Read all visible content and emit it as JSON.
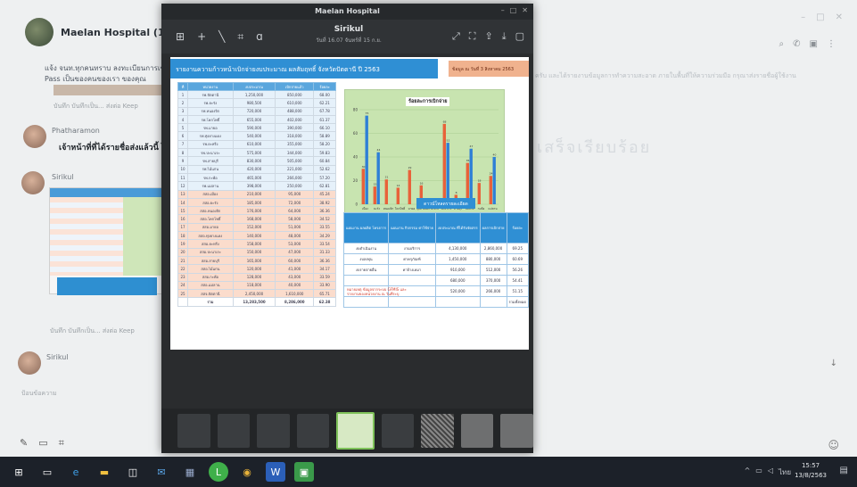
{
  "chat": {
    "group_name": "Maelan Hospital (171)",
    "first_message": "แจ้ง จนท.ทุกคนทราบ ลงทะเบียนการเข้าร่วม...",
    "first_message_sub": "Pass เป็นของคนของเรา ของคุณ",
    "read_meta": "บันทึก   บันทึกเป็น...   ส่งต่อ   Keep",
    "sender1": "Phatharamon",
    "bubble1": "เจ้าหน้าที่ที่ได้รายชื่อส่งแล้วนี้ ไ",
    "sender2": "Sirikul",
    "read_meta2": "บันทึก   บันทึกเป็น...   ส่งต่อ   Keep",
    "sender3": "Sirikul",
    "input_placeholder": "ป้อนข้อความ",
    "bg_text": "ครับ และได้รายงานข้อมูลการทำความสะอาด ภายในพื้นที่ให้ความร่วมมือ กรุณาส่งรายชื่อผู้ใช้งาน",
    "bg_big": "เสร็จเรียบร้อย"
  },
  "viewer": {
    "title": "Maelan Hospital",
    "sender": "Sirikul",
    "date": "วันที่ 16.07 จันทร์ที่ 15 ก.ย.",
    "doc_title": "รายงานความก้าวหน้าเบิกจ่ายงบประมาณ ผลสัมฤทธิ์ จังหวัดปัตตานี ปี 2563",
    "doc_badge": "ข้อมูล ณ วันที่ 3 สิงหาคม 2563",
    "table_headers": [
      "ที่",
      "หน่วยงาน",
      "งบประมาณ",
      "เบิกจ่ายแล้ว",
      "ร้อยละ"
    ],
    "table_rows": [
      [
        "1",
        "รพ.ปัตตานี",
        "1,250,000",
        "850,000",
        "68.00"
      ],
      [
        "2",
        "รพ.ยะรัง",
        "980,500",
        "610,000",
        "62.21"
      ],
      [
        "3",
        "รพ.หนองจิก",
        "720,000",
        "488,000",
        "67.78"
      ],
      [
        "4",
        "รพ.โคกโพธิ์",
        "655,000",
        "402,000",
        "61.37"
      ],
      [
        "5",
        "รพ.มายอ",
        "590,000",
        "390,000",
        "66.10"
      ],
      [
        "6",
        "รพ.ทุ่งยางแดง",
        "540,000",
        "318,000",
        "58.89"
      ],
      [
        "7",
        "รพ.ยะหริ่ง",
        "610,000",
        "355,000",
        "58.20"
      ],
      [
        "8",
        "รพ.ปะนาเระ",
        "575,000",
        "344,000",
        "59.83"
      ],
      [
        "9",
        "รพ.สายบุรี",
        "830,000",
        "505,000",
        "60.84"
      ],
      [
        "10",
        "รพ.ไม้แก่น",
        "420,000",
        "221,000",
        "52.62"
      ],
      [
        "11",
        "รพ.กะพ้อ",
        "465,000",
        "266,000",
        "57.20"
      ],
      [
        "12",
        "รพ.แม่ลาน",
        "398,000",
        "250,000",
        "62.81"
      ],
      [
        "13",
        "สสอ.เมือง",
        "210,000",
        "95,000",
        "45.24"
      ],
      [
        "14",
        "สสอ.ยะรัง",
        "185,000",
        "72,000",
        "38.92"
      ],
      [
        "15",
        "สสอ.หนองจิก",
        "176,000",
        "64,000",
        "36.36"
      ],
      [
        "16",
        "สสอ.โคกโพธิ์",
        "168,000",
        "58,000",
        "34.52"
      ],
      [
        "17",
        "สสอ.มายอ",
        "152,000",
        "51,000",
        "33.55"
      ],
      [
        "18",
        "สสอ.ทุ่งยางแดง",
        "140,000",
        "48,000",
        "34.29"
      ],
      [
        "19",
        "สสอ.ยะหริ่ง",
        "158,000",
        "53,000",
        "33.54"
      ],
      [
        "20",
        "สสอ.ปะนาเระ",
        "150,000",
        "47,000",
        "31.33"
      ],
      [
        "21",
        "สสอ.สายบุรี",
        "165,000",
        "60,000",
        "36.36"
      ],
      [
        "22",
        "สสอ.ไม้แก่น",
        "120,000",
        "41,000",
        "34.17"
      ],
      [
        "23",
        "สสอ.กะพ้อ",
        "128,000",
        "43,000",
        "33.59"
      ],
      [
        "24",
        "สสอ.แม่ลาน",
        "118,000",
        "40,000",
        "33.90"
      ],
      [
        "25",
        "สสจ.ปัตตานี",
        "2,450,000",
        "1,610,000",
        "65.71"
      ]
    ],
    "table_total": [
      "",
      "รวม",
      "13,283,500",
      "8,286,000",
      "62.38"
    ],
    "chart_title": "ร้อยละการเบิกจ่าย",
    "chart_legend": "■ โรงพยาบาล   ■ สำนักงานสาธารณสุขอำเภอ",
    "download_label": "ดาวน์โหลดรายละเอียด",
    "summary_headers": [
      "แผนงาน ผลผลิต โครงการ",
      "แผนงาน กิจกรรม ค่าใช้จ่าย",
      "งบประมาณ ที่ได้รับจัดสรร",
      "ผลการเบิกจ่าย",
      "ร้อยละ"
    ],
    "summary_rows": [
      [
        "งบดำเนินงาน",
        "งานบริการ",
        "4,130,000",
        "2,860,000",
        "69.25"
      ],
      [
        "งบลงทุน",
        "ค่าครุภัณฑ์",
        "1,450,000",
        "880,000",
        "60.69"
      ],
      [
        "งบรายจ่ายอื่น",
        "ค่าจ้างเหมา",
        "910,000",
        "512,000",
        "56.26"
      ],
      [
        "",
        "",
        "680,000",
        "370,000",
        "54.41"
      ],
      [
        "",
        "",
        "520,000",
        "266,000",
        "51.15"
      ],
      [
        "",
        "",
        "",
        "",
        "รวมทั้งหมด"
      ]
    ],
    "summary_side_label": "ร้อยละ เบิกจ่าย ภาพรวม",
    "summary_side_value": "62.38",
    "note": "หมายเหตุ ข้อมูลจากระบบ GFMIS และรายงานของหน่วยงาน ณ วันที่ระบุ"
  },
  "taskbar": {
    "time": "15:57",
    "date": "13/8/2563",
    "tray_lang": "ไทย"
  },
  "chart_data": {
    "type": "bar",
    "title": "ร้อยละการเบิกจ่าย",
    "categories": [
      "เมือง",
      "ยะรัง",
      "หนองจิก",
      "โคกโพธิ์",
      "มายอ",
      "ทุ่งยางแดง",
      "ยะหริ่ง",
      "ปะนาเระ",
      "สายบุรี",
      "ไม้แก่น",
      "กะพ้อ",
      "แม่ลาน"
    ],
    "series": [
      {
        "name": "โรงพยาบาล",
        "values": [
          30,
          15,
          21,
          14,
          29,
          16,
          0,
          68,
          8,
          35,
          18,
          24
        ],
        "color": "#e8623a"
      },
      {
        "name": "สำนักงานสาธารณสุขอำเภอ",
        "values": [
          75,
          44,
          0,
          0,
          0,
          0,
          0,
          52,
          0,
          47,
          0,
          40
        ],
        "color": "#2f7fd6"
      }
    ],
    "ylim": [
      0,
      80
    ]
  }
}
